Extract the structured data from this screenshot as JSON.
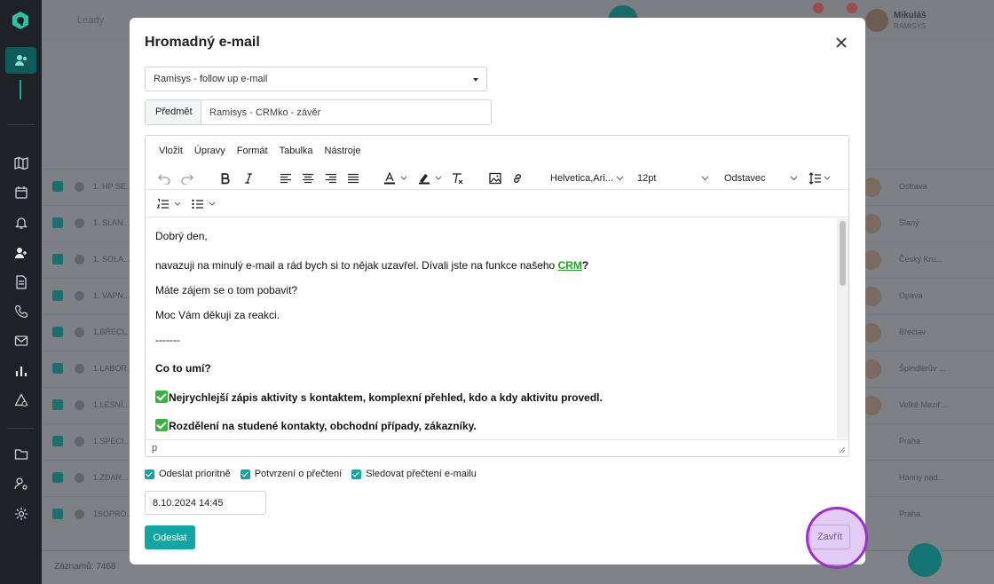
{
  "app": {
    "breadcrumb": "Leady",
    "user_name": "Mikuláš",
    "user_sub": "RAMISYS",
    "table_rows": [
      {
        "name": "1. HP SE...",
        "city": "Ostrava"
      },
      {
        "name": "1. SLAN...",
        "city": "Slaný"
      },
      {
        "name": "1. SOLA...",
        "city": "Český Kru..."
      },
      {
        "name": "1. VAPN...",
        "city": "Opava"
      },
      {
        "name": "1.BŘECL...",
        "city": "Břeclav"
      },
      {
        "name": "1.LABOR...",
        "city": "Špindlerův ..."
      },
      {
        "name": "1.LESNÍ...",
        "city": "Velké Meziř..."
      },
      {
        "name": "1.SPECI...",
        "city": "Praha"
      },
      {
        "name": "1.ZDAR...",
        "city": "Hanny nad..."
      },
      {
        "name": "1SOPRO...",
        "city": "Praha"
      }
    ],
    "footer_records": "Záznamů: 7468"
  },
  "modal": {
    "title": "Hromadný e-mail",
    "template_select": "Ramisys - follow up e-mail",
    "subject_label": "Předmět",
    "subject_value": "Ramisys - CRMko - závěr",
    "menu": [
      "Vložit",
      "Úpravy",
      "Formát",
      "Tabulka",
      "Nástroje"
    ],
    "toolbar": {
      "font_family": "Helvetica,Ari...",
      "font_size": "12pt",
      "block_format": "Odstavec"
    },
    "content": {
      "greeting": "Dobrý den,",
      "line1_pre": "navazuji na minulý e-mail a rád bych si to nějak uzavřel. Dívali jste na funkce našeho ",
      "line1_link": "CRM",
      "line1_post": "?",
      "line2": "Máte zájem se o tom pobavit?",
      "line3": "Moc Vám děkuji za reakci.",
      "divider": "-------",
      "heading": "Co to umí?",
      "bullet1": "Nejrychlejší zápis aktivity s kontaktem, komplexní přehled, kdo a kdy aktivitu provedl.",
      "bullet2": "Rozdělení na studené kontakty, obchodní případy, zákazníky."
    },
    "statusbar_path": "p",
    "checkboxes": [
      {
        "label": "Odeslat prioritně",
        "checked": true
      },
      {
        "label": "Potvrzení o přečtení",
        "checked": true
      },
      {
        "label": "Sledovat přečtení e-mailu",
        "checked": true
      }
    ],
    "send_date": "8.10.2024 14:45",
    "send_button": "Odeslat",
    "close_button": "Zavřít"
  },
  "colors": {
    "accent": "#11a6a1",
    "link_green": "#1ea51e",
    "highlight": "#9c2fd1"
  }
}
